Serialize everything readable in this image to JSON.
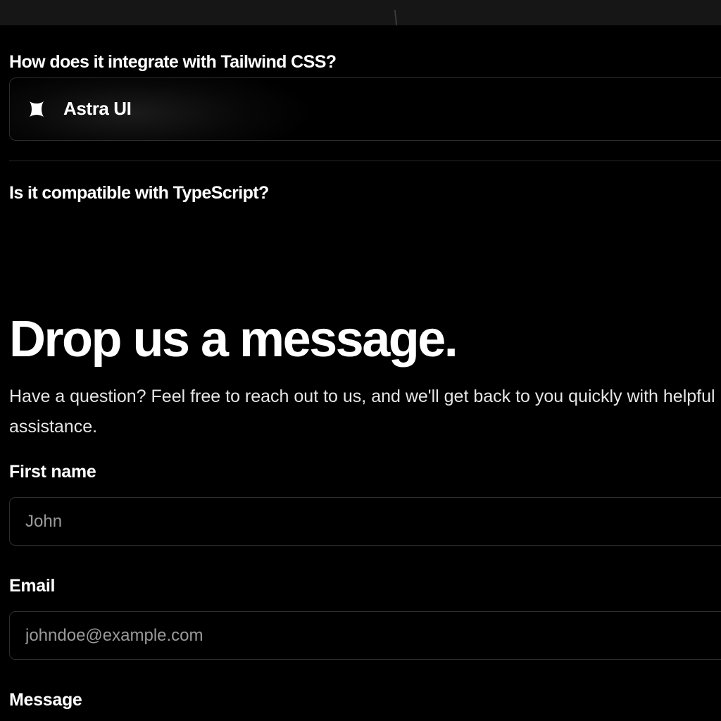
{
  "faq": {
    "question_1": "How does it integrate with Tailwind CSS?",
    "brand_name": "Astra UI",
    "brand_icon": "four-point-star-icon",
    "question_2": "Is it compatible with TypeScript?"
  },
  "contact": {
    "title": "Drop us a message.",
    "subtitle": "Have a question? Feel free to reach out to us, and we'll get back to you quickly with helpful assistance.",
    "first_name_label": "First name",
    "first_name_placeholder": "John",
    "email_label": "Email",
    "email_placeholder": "johndoe@example.com",
    "message_label": "Message"
  },
  "colors": {
    "background": "#000000",
    "text": "#ffffff",
    "placeholder": "#9a9a9a",
    "border": "#2e2e2e"
  }
}
